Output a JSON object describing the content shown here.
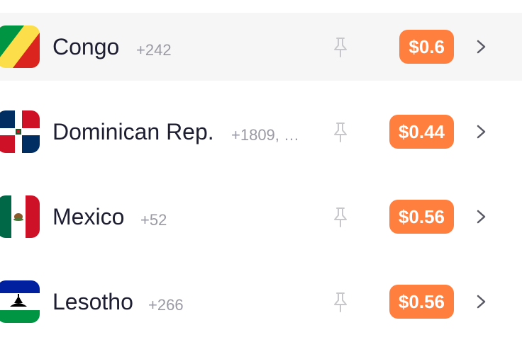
{
  "countries": [
    {
      "name": "Congo",
      "code": "+242",
      "price": "$0.6",
      "flag_icon": "congo-flag-icon",
      "highlighted": true
    },
    {
      "name": "Dominican Rep.",
      "code": "+1809, +…",
      "price": "$0.44",
      "flag_icon": "dominican-republic-flag-icon",
      "highlighted": false
    },
    {
      "name": "Mexico",
      "code": "+52",
      "price": "$0.56",
      "flag_icon": "mexico-flag-icon",
      "highlighted": false
    },
    {
      "name": "Lesotho",
      "code": "+266",
      "price": "$0.56",
      "flag_icon": "lesotho-flag-icon",
      "highlighted": false
    }
  ],
  "icons": {
    "pin": "pin-icon",
    "chevron": "chevron-right-icon"
  },
  "colors": {
    "price_badge": "#ff7f3f",
    "row_highlight": "#f6f6f6",
    "name_text": "#1e1e33",
    "code_text": "#9a9aa4",
    "pin_icon": "#c8c8cc",
    "chevron_icon": "#5a5a66"
  }
}
